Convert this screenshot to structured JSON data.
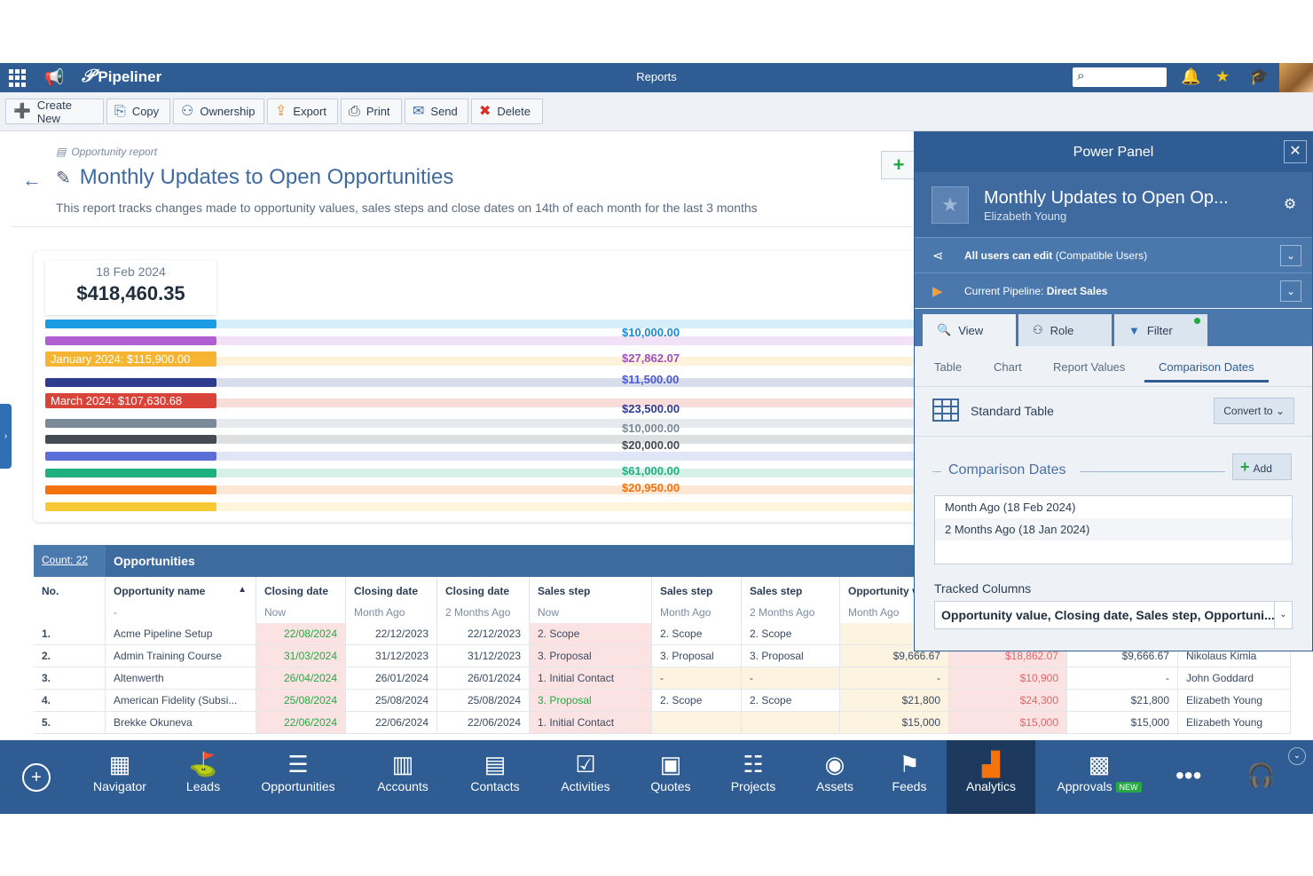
{
  "app": {
    "logo": "Pipeliner",
    "title": "Reports"
  },
  "toolbar": [
    {
      "label": "Create New",
      "icon": "plus-icon",
      "glyph": "➕",
      "color": "#28a745"
    },
    {
      "label": "Copy",
      "icon": "copy-icon",
      "glyph": "⎘",
      "color": "#3f6aa0"
    },
    {
      "label": "Ownership",
      "icon": "hierarchy-icon",
      "glyph": "⚇",
      "color": "#3f6aa0"
    },
    {
      "label": "Export",
      "icon": "export-icon",
      "glyph": "⇪",
      "color": "#e08a1e"
    },
    {
      "label": "Print",
      "icon": "print-icon",
      "glyph": "⎙",
      "color": "#3a4a60"
    },
    {
      "label": "Send",
      "icon": "mail-icon",
      "glyph": "✉",
      "color": "#3f6aa0"
    },
    {
      "label": "Delete",
      "icon": "delete-icon",
      "glyph": "✖",
      "color": "#d93025"
    }
  ],
  "report": {
    "kind": "Opportunity report",
    "title": "Monthly Updates to Open Opportunities",
    "description": "This report tracks changes made to opportunity values, sales steps and close dates on 14th of each month for the last 3 months"
  },
  "sankey": {
    "date": "18 Feb 2024",
    "total": "$418,460.35",
    "bar_colors": [
      "#1a9be3",
      "#b05fd0",
      "#f5b532",
      "#2e3c8f",
      "#d9443a",
      "#7a8a98",
      "#444b52",
      "#5b6ed8",
      "#1fb082",
      "#f5720d",
      "#f7c934"
    ],
    "bar_labels": [
      {
        "index": 2,
        "text": "January 2024: $115,900.00"
      },
      {
        "index": 4,
        "text": "March 2024: $107,630.68"
      }
    ],
    "values": [
      {
        "text": "$10,000.00",
        "color": "#1a8ad0"
      },
      {
        "text": "$27,862.07",
        "color": "#a04fc6"
      },
      {
        "text": "$11,500.00",
        "color": "#4a5ad0"
      },
      {
        "text": "$23,500.00",
        "color": "#2e3c8f"
      },
      {
        "text": "$10,000.00",
        "color": "#7a8a98"
      },
      {
        "text": "$20,000.00",
        "color": "#444b52"
      },
      {
        "text": "$61,000.00",
        "color": "#1fb082"
      },
      {
        "text": "$20,950.00",
        "color": "#f5720d"
      }
    ]
  },
  "table": {
    "count": "Count: 22",
    "header": "Opportunities",
    "columns": [
      {
        "name": "No.",
        "sub": ""
      },
      {
        "name": "Opportunity name",
        "sub": "-"
      },
      {
        "name": "Closing date",
        "sub": "Now"
      },
      {
        "name": "Closing date",
        "sub": "Month Ago"
      },
      {
        "name": "Closing date",
        "sub": "2 Months Ago"
      },
      {
        "name": "Sales step",
        "sub": "Now"
      },
      {
        "name": "Sales step",
        "sub": "Month Ago"
      },
      {
        "name": "Sales step",
        "sub": "2 Months Ago"
      },
      {
        "name": "Opportunity v",
        "sub": "Month Ago"
      }
    ],
    "rows": [
      [
        "1.",
        "Acme Pipeline Setup",
        "22/08/2024",
        "22/12/2023",
        "22/12/2023",
        "2. Scope",
        "2. Scope",
        "2. Scope",
        "$",
        "",
        "",
        ""
      ],
      [
        "2.",
        "Admin Training Course",
        "31/03/2024",
        "31/12/2023",
        "31/12/2023",
        "3. Proposal",
        "3. Proposal",
        "3. Proposal",
        "$9,666.67",
        "$18,862.07",
        "$9,666.67",
        "Nikolaus Kimla"
      ],
      [
        "3.",
        "Altenwerth",
        "26/04/2024",
        "26/01/2024",
        "26/01/2024",
        "1. Initial Contact",
        "-",
        "-",
        "-",
        "$10,900",
        "-",
        "John Goddard"
      ],
      [
        "4.",
        "American Fidelity (Subsi...",
        "25/08/2024",
        "25/08/2024",
        "25/08/2024",
        "3. Proposal",
        "2. Scope",
        "2. Scope",
        "$21,800",
        "$24,300",
        "$21,800",
        "Elizabeth Young"
      ],
      [
        "5.",
        "Brekke Okuneva",
        "22/06/2024",
        "22/06/2024",
        "22/06/2024",
        "1. Initial Contact",
        "",
        "",
        "$15,000",
        "$15,000",
        "$15,000",
        "Elizabeth Young"
      ]
    ]
  },
  "power_panel": {
    "title": "Power Panel",
    "report_name": "Monthly Updates to Open Op...",
    "owner": "Elizabeth Young",
    "sharing_bold": "All users can edit",
    "sharing_rest": " (Compatible Users)",
    "pipeline_prefix": "Current Pipeline: ",
    "pipeline_name": "Direct Sales",
    "tabs": [
      "View",
      "Role",
      "Filter"
    ],
    "sub_tabs": [
      "Table",
      "Chart",
      "Report Values",
      "Comparison Dates"
    ],
    "table_type": "Standard Table",
    "convert_label": "Convert to",
    "comparison_title": "Comparison Dates",
    "add_label": "Add",
    "comparison_dates": [
      "Month Ago (18 Feb 2024)",
      "2 Months Ago (18 Jan 2024)"
    ],
    "tracked_label": "Tracked Columns",
    "tracked_value": "Opportunity value, Closing date, Sales step, Opportuni..."
  },
  "bottom_nav": [
    {
      "label": "Navigator",
      "icon": "navigator-icon",
      "glyph": "▦"
    },
    {
      "label": "Leads",
      "icon": "leads-icon",
      "glyph": "⛳"
    },
    {
      "label": "Opportunities",
      "icon": "opportunities-icon",
      "glyph": "☰"
    },
    {
      "label": "Accounts",
      "icon": "accounts-icon",
      "glyph": "▥"
    },
    {
      "label": "Contacts",
      "icon": "contacts-icon",
      "glyph": "▤"
    },
    {
      "label": "Activities",
      "icon": "activities-icon",
      "glyph": "☑"
    },
    {
      "label": "Quotes",
      "icon": "quotes-icon",
      "glyph": "▣"
    },
    {
      "label": "Projects",
      "icon": "projects-icon",
      "glyph": "☷"
    },
    {
      "label": "Assets",
      "icon": "assets-icon",
      "glyph": "◉"
    },
    {
      "label": "Feeds",
      "icon": "feeds-icon",
      "glyph": "⚑"
    },
    {
      "label": "Analytics",
      "icon": "analytics-icon",
      "glyph": "▟"
    },
    {
      "label": "Approvals",
      "icon": "approvals-icon",
      "glyph": "▩",
      "badge": "NEW"
    }
  ]
}
